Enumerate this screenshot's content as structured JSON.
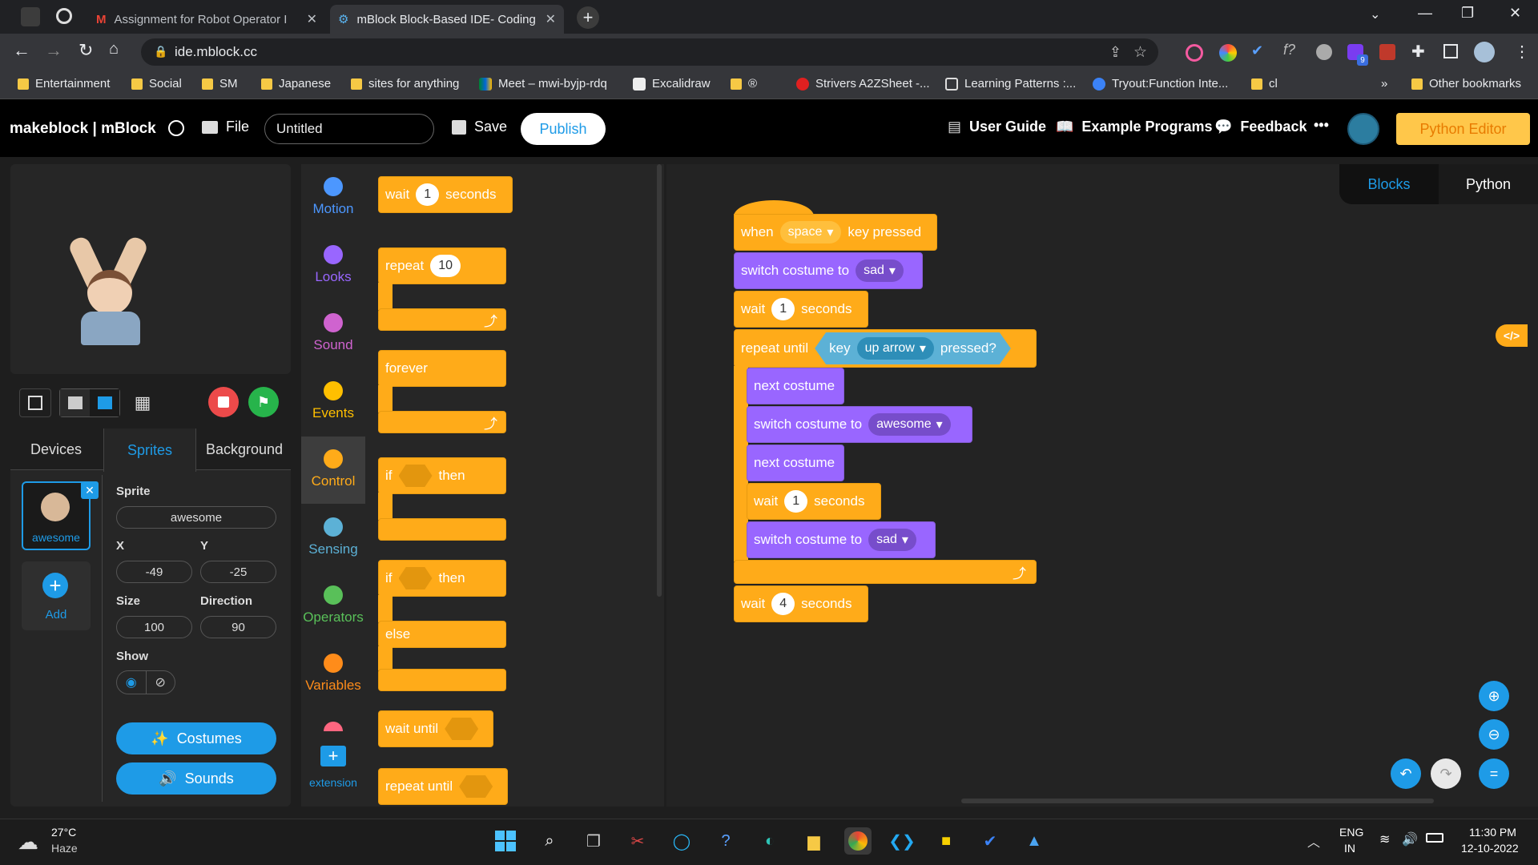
{
  "browser": {
    "tabs": [
      {
        "title": "Assignment for Robot Operator I",
        "icon": "gmail-icon"
      },
      {
        "title": "mBlock Block-Based IDE- Coding",
        "icon": "mblock-icon"
      }
    ],
    "url": "ide.mblock.cc",
    "bookmarks": [
      "Entertainment",
      "Social",
      "SM",
      "Japanese",
      "sites for anything",
      "Meet – mwi-byjp-rdq",
      "Excalidraw",
      "®",
      "Strivers A2ZSheet -...",
      "Learning Patterns :...",
      "Tryout:Function Inte...",
      "cl"
    ],
    "more": "»",
    "other_bookmarks": "Other bookmarks",
    "extension_badge": "9"
  },
  "header": {
    "brand": "makeblock | mBlock",
    "file": "File",
    "project_name": "Untitled",
    "save": "Save",
    "publish": "Publish",
    "user_guide": "User Guide",
    "example_programs": "Example Programs",
    "feedback": "Feedback",
    "more": "•••",
    "python_editor": "Python Editor"
  },
  "side": {
    "tabs": [
      "Devices",
      "Sprites",
      "Background"
    ],
    "active_tab": "Sprites",
    "sprite_card": "awesome",
    "add": "Add",
    "sprite_label": "Sprite",
    "sprite_name": "awesome",
    "x_label": "X",
    "x": "-49",
    "y_label": "Y",
    "y": "-25",
    "size_label": "Size",
    "size": "100",
    "direction_label": "Direction",
    "direction": "90",
    "show_label": "Show",
    "costumes": "Costumes",
    "sounds": "Sounds"
  },
  "categories": [
    {
      "name": "Motion",
      "color": "#4c97ff"
    },
    {
      "name": "Looks",
      "color": "#9966ff"
    },
    {
      "name": "Sound",
      "color": "#cf63cf"
    },
    {
      "name": "Events",
      "color": "#ffbf00"
    },
    {
      "name": "Control",
      "color": "#ffab19"
    },
    {
      "name": "Sensing",
      "color": "#5cb1d6"
    },
    {
      "name": "Operators",
      "color": "#59c059"
    },
    {
      "name": "Variables",
      "color": "#ff8c1a"
    }
  ],
  "extension": "extension",
  "palette": {
    "wait": "wait",
    "wait_val": "1",
    "seconds": "seconds",
    "repeat": "repeat",
    "repeat_val": "10",
    "forever": "forever",
    "if": "if",
    "then": "then",
    "else": "else",
    "wait_until": "wait until",
    "repeat_until": "repeat until"
  },
  "workspace_tabs": [
    "Blocks",
    "Python"
  ],
  "script": {
    "when": "when",
    "key": "space",
    "key_pressed": "key pressed",
    "switch_costume": "switch costume to",
    "sad": "sad",
    "wait": "wait",
    "one": "1",
    "seconds": "seconds",
    "repeat_until": "repeat until",
    "sense_key": "key",
    "up_arrow": "up arrow",
    "pressed": "pressed?",
    "next_costume": "next costume",
    "awesome": "awesome",
    "four": "4"
  },
  "code_toggle": "</>",
  "taskbar": {
    "temp": "27°C",
    "weather": "Haze",
    "lang1": "ENG",
    "lang2": "IN",
    "time": "11:30 PM",
    "date": "12-10-2022"
  }
}
